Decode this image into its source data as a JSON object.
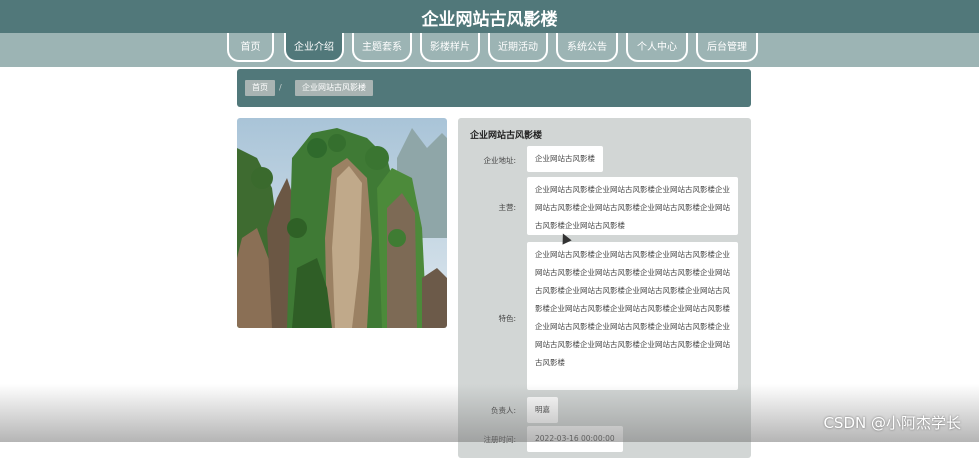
{
  "header": {
    "title": "企业网站古风影楼"
  },
  "nav": {
    "items": [
      {
        "label": "首页"
      },
      {
        "label": "企业介绍"
      },
      {
        "label": "主题套系"
      },
      {
        "label": "影楼样片"
      },
      {
        "label": "近期活动"
      },
      {
        "label": "系统公告"
      },
      {
        "label": "个人中心"
      },
      {
        "label": "后台管理"
      }
    ],
    "active_index": 1
  },
  "breadcrumb": {
    "home": "首页",
    "separator": "/",
    "current": "企业网站古风影楼"
  },
  "detail": {
    "title": "企业网站古风影楼",
    "address_label": "企业地址:",
    "address_value": "企业网站古风影楼",
    "business_label": "主营:",
    "business_value": "企业网站古风影楼企业网站古风影楼企业网站古风影楼企业网站古风影楼企业网站古风影楼企业网站古风影楼企业网站古风影楼企业网站古风影楼",
    "feature_label": "特色:",
    "feature_value": "企业网站古风影楼企业网站古风影楼企业网站古风影楼企业网站古风影楼企业网站古风影楼企业网站古风影楼企业网站古风影楼企业网站古风影楼企业网站古风影楼企业网站古风影楼企业网站古风影楼企业网站古风影楼企业网站古风影楼企业网站古风影楼企业网站古风影楼企业网站古风影楼企业网站古风影楼企业网站古风影楼企业网站古风影楼企业网站古风影楼",
    "manager_label": "负责人:",
    "manager_value": "明嘉",
    "registered_label": "注册时间:",
    "registered_value": "2022-03-16 00:00:00"
  },
  "watermark": "CSDN @小阿杰学长",
  "colors": {
    "primary": "#51787a",
    "nav_bg": "#9cb4b4",
    "panel_bg": "#d2d6d5"
  }
}
